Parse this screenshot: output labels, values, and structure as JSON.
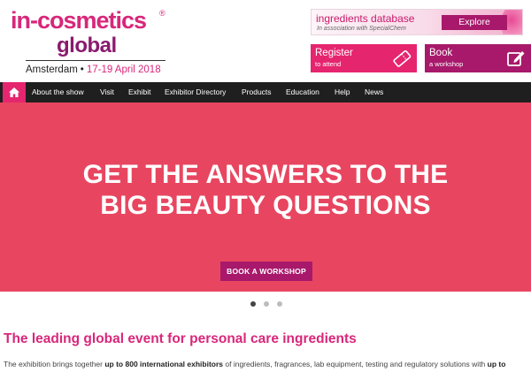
{
  "logo": {
    "main": "in-cosmetics",
    "reg": "®",
    "sub": "global",
    "city": "Amsterdam",
    "separator": "•",
    "dates": "17-19 April 2018"
  },
  "ingredients_db": {
    "title": "ingredients database",
    "association": "In association with SpecialChem",
    "explore_label": "Explore"
  },
  "cta": {
    "register_title": "Register",
    "register_sub": "to attend",
    "book_title": "Book",
    "book_sub": "a workshop"
  },
  "nav": {
    "items": [
      "About the show",
      "Visit",
      "Exhibit",
      "Exhibitor Directory",
      "Products",
      "Education",
      "Help",
      "News"
    ]
  },
  "hero": {
    "line1": "GET THE ANSWERS TO THE",
    "line2": "BIG BEAUTY QUESTIONS",
    "button_label": "BOOK A WORKSHOP"
  },
  "carousel": {
    "slides": 3,
    "active": 1
  },
  "intro": {
    "title": "The leading global event for personal care ingredients",
    "text_1": "The exhibition brings together ",
    "text_bold_1": "up to 800 international exhibitors",
    "text_2": " of ingredients, fragrances, lab equipment, testing and regulatory solutions with ",
    "text_bold_2": "up to"
  },
  "colors": {
    "brand_pink": "#d8277a",
    "brand_purple": "#a8196b",
    "hero_bg": "#e84660",
    "nav_bg": "#1f1f1f"
  }
}
